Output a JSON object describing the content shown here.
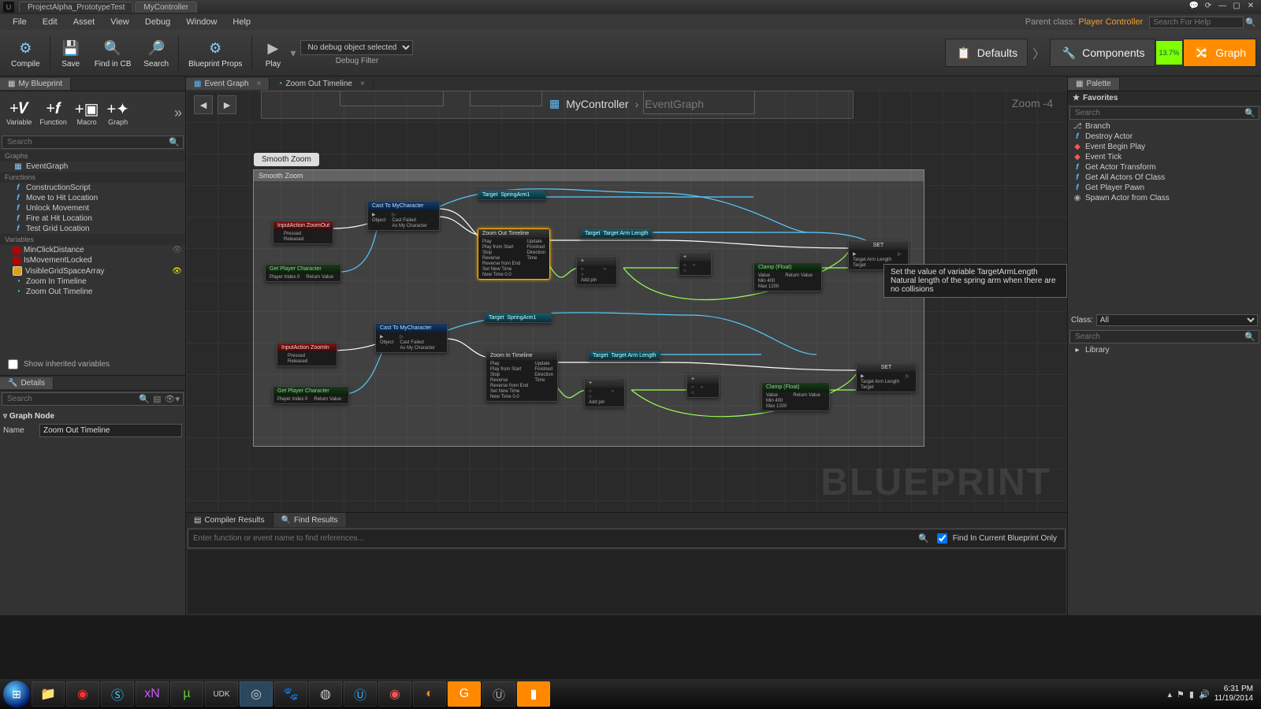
{
  "titlebar": {
    "tabs": [
      "ProjectAlpha_PrototypeTest",
      "MyController"
    ]
  },
  "menubar": {
    "items": [
      "File",
      "Edit",
      "Asset",
      "View",
      "Debug",
      "Window",
      "Help"
    ],
    "parent_class_label": "Parent class:",
    "parent_class_value": "Player Controller",
    "search_placeholder": "Search For Help"
  },
  "toolbar": {
    "compile": "Compile",
    "save": "Save",
    "find": "Find in CB",
    "search": "Search",
    "props": "Blueprint Props",
    "play": "Play",
    "debug_selected": "No debug object selected",
    "debug_label": "Debug Filter",
    "defaults": "Defaults",
    "components": "Components",
    "graph": "Graph",
    "cpu": "13.7%"
  },
  "mybp": {
    "title": "My Blueprint",
    "buttons": {
      "var": "Variable",
      "fn": "Function",
      "macro": "Macro",
      "graph": "Graph"
    },
    "search_placeholder": "Search",
    "sections": {
      "graphs": "Graphs",
      "functions": "Functions",
      "variables": "Variables"
    },
    "graphs": [
      "EventGraph"
    ],
    "functions": [
      "ConstructionScript",
      "Move to Hit Location",
      "Unlock Movement",
      "Fire at Hit Location",
      "Test Grid Location"
    ],
    "variables": [
      {
        "name": "MinClickDistance",
        "color": "#b00"
      },
      {
        "name": "IsMovementLocked",
        "color": "#b00"
      },
      {
        "name": "VisibleGridSpaceArray",
        "color": "#d8a020"
      }
    ],
    "timelines": [
      "Zoom In Timeline",
      "Zoom Out Timeline"
    ],
    "show_inherited": "Show inherited variables"
  },
  "details": {
    "title": "Details",
    "search_placeholder": "Search",
    "group": "Graph Node",
    "name_label": "Name",
    "name_value": "Zoom Out Timeline"
  },
  "graph": {
    "tabs": [
      "Event Graph",
      "Zoom Out Timeline"
    ],
    "breadcrumb": [
      "MyController",
      "EventGraph"
    ],
    "zoom": "Zoom -4",
    "comment_title": "Smooth Zoom",
    "comment_hdr": "Smooth Zoom",
    "watermark": "BLUEPRINT",
    "tooltip": "Set the value of variable TargetArmLength\nNatural length of the spring arm when there are no collisions",
    "nodes": {
      "ia_out": "InputAction ZoomOut",
      "ia_in": "InputAction ZoomIn",
      "cast": "Cast To MyCharacter",
      "getplayer": "Get Player Character",
      "springarm": "SpringArm1",
      "target": "Target",
      "tal": "Target Arm Length",
      "tl_out": "Zoom Out Timeline",
      "tl_in": "Zoom In Timeline",
      "addpin": "Add pin",
      "clamp": "Clamp (Float)",
      "set": "SET",
      "pins": {
        "pressed": "Pressed",
        "released": "Released",
        "object": "Object",
        "castfailed": "Cast Failed",
        "asmychar": "As My Character",
        "play": "Play",
        "playfromstart": "Play from Start",
        "stop": "Stop",
        "reverse": "Reverse",
        "reversefromend": "Reverse from End",
        "setnewtime": "Set New Time",
        "newtime": "New Time  0.0",
        "update": "Update",
        "finished": "Finished",
        "direction": "Direction",
        "time": "Time",
        "value": "Value",
        "min": "Min  400",
        "max": "Max  1200",
        "retval": "Return Value",
        "playerindex": "Player Index  0",
        "settal": "Target Arm Length",
        "settgt": "Target"
      }
    }
  },
  "bottom": {
    "tabs": [
      "Compiler Results",
      "Find Results"
    ],
    "find_placeholder": "Enter function or event name to find references...",
    "find_current": "Find In Current Blueprint Only"
  },
  "palette": {
    "title": "Palette",
    "fav": "Favorites",
    "search_placeholder": "Search",
    "items": [
      "Branch",
      "Destroy Actor",
      "Event Begin Play",
      "Event Tick",
      "Get Actor Transform",
      "Get All Actors Of Class",
      "Get Player Pawn",
      "Spawn Actor from Class"
    ],
    "class_label": "Class:",
    "class_value": "All",
    "lib_search_placeholder": "Search",
    "library": "Library"
  },
  "taskbar": {
    "time": "6:31 PM",
    "date": "11/19/2014"
  }
}
